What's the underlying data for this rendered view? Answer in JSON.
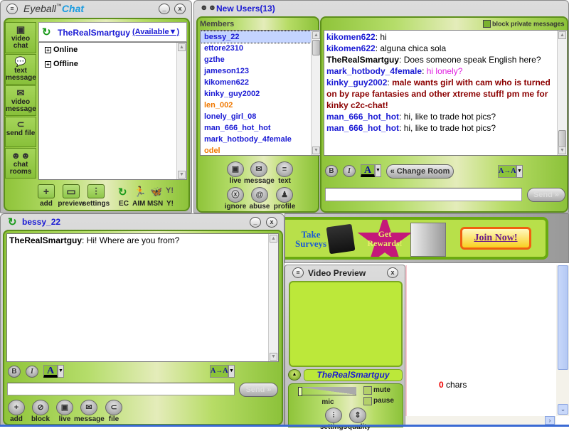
{
  "main_window": {
    "title_brand": "Eyeball",
    "title_tm": "™",
    "title_suffix": "Chat",
    "user": "TheRealSmartguy",
    "status": "(Available▼)",
    "groups": [
      "Online",
      "Offline"
    ],
    "sidebar": [
      {
        "icon": "video-chat",
        "label": "video chat"
      },
      {
        "icon": "text-message",
        "label": "text message"
      },
      {
        "icon": "video-message",
        "label": "video message"
      },
      {
        "icon": "send-file",
        "label": "send file"
      },
      {
        "icon": "chat-rooms",
        "label": "chat rooms"
      }
    ],
    "toolbar": [
      {
        "icon": "plus",
        "label": "add"
      },
      {
        "icon": "monitor",
        "label": "preview"
      },
      {
        "icon": "sliders",
        "label": "settings"
      }
    ],
    "networks": [
      "EC",
      "AIM",
      "MSN",
      "Y!"
    ]
  },
  "room_window": {
    "title": "New Users(13)",
    "members_label": "Members",
    "members": [
      {
        "name": "bessy_22",
        "color": "#1a1ad4",
        "selected": true
      },
      {
        "name": "ettore2310",
        "color": "#1a1ad4"
      },
      {
        "name": "gzthe",
        "color": "#1a1ad4"
      },
      {
        "name": "jameson123",
        "color": "#1a1ad4"
      },
      {
        "name": "kikomen622",
        "color": "#1a1ad4"
      },
      {
        "name": "kinky_guy2002",
        "color": "#1a1ad4"
      },
      {
        "name": "len_002",
        "color": "#f07800"
      },
      {
        "name": "lonely_girl_08",
        "color": "#1a1ad4"
      },
      {
        "name": "man_666_hot_hot",
        "color": "#1a1ad4"
      },
      {
        "name": "mark_hotbody_4female",
        "color": "#1a1ad4"
      },
      {
        "name": "odel",
        "color": "#f07800"
      }
    ],
    "actions_row1": [
      {
        "icon": "camera",
        "label": "live"
      },
      {
        "icon": "video-mail",
        "label": "message"
      },
      {
        "icon": "speech-bubble",
        "label": "text"
      }
    ],
    "actions_row2": [
      {
        "icon": "ignore",
        "label": "ignore"
      },
      {
        "icon": "abuse",
        "label": "abuse"
      },
      {
        "icon": "person",
        "label": "profile"
      }
    ],
    "block_private_label": "block private messages",
    "messages": [
      {
        "user": "kikomen622",
        "user_color": "#1a1ad4",
        "text": "hi",
        "text_color": "#000",
        "bold": false
      },
      {
        "user": "kikomen622",
        "user_color": "#1a1ad4",
        "text": "alguna chica sola",
        "text_color": "#000",
        "bold": false
      },
      {
        "user": "TheRealSmartguy",
        "user_color": "#000",
        "text": "Does someone speak English here?",
        "text_color": "#000",
        "bold": false
      },
      {
        "user": "mark_hotbody_4female",
        "user_color": "#1a1ad4",
        "text": "hi lonely?",
        "text_color": "#e020e0",
        "bold": false
      },
      {
        "user": "kinky_guy2002",
        "user_color": "#1a1ad4",
        "text": "male wants girl with cam who is turned on by rape fantasies and other xtreme stuff! pm me for kinky c2c-chat!",
        "text_color": "#8b0000",
        "bold": true
      },
      {
        "user": "man_666_hot_hot",
        "user_color": "#1a1ad4",
        "text": "hi, like to trade hot pics?",
        "text_color": "#000",
        "bold": false
      },
      {
        "user": "man_666_hot_hot",
        "user_color": "#1a1ad4",
        "text": "hi, like to trade hot pics?",
        "text_color": "#000",
        "bold": false
      }
    ],
    "bold_label": "B",
    "italic_label": "I",
    "color_label": "A",
    "change_room_label": "« Change Room",
    "font_size_label": "A→A",
    "input_value": "",
    "send_label": "Send »"
  },
  "private_window": {
    "title": "bessy_22",
    "messages": [
      {
        "user": "TheRealSmartguy",
        "text": "Hi! Where are you from?"
      }
    ],
    "bold_label": "B",
    "italic_label": "I",
    "color_label": "A",
    "font_size_label": "A→A",
    "input_value": "",
    "send_label": "Send »",
    "actions": [
      {
        "icon": "plus",
        "label": "add"
      },
      {
        "icon": "block",
        "label": "block"
      },
      {
        "icon": "camera",
        "label": "live"
      },
      {
        "icon": "video-mail",
        "label": "message"
      },
      {
        "icon": "paperclip",
        "label": "file"
      }
    ]
  },
  "ad_banner": {
    "left_text": "Take Surveys",
    "star_text": "Get Rewards!",
    "button_label": "Join Now!"
  },
  "video_preview": {
    "title": "Video Preview",
    "user": "TheRealSmartguy",
    "mic_label": "mic",
    "mic_level": 0.0,
    "mute_label": "mute",
    "pause_label": "pause",
    "settings_label": "settings",
    "quality_label": "quality"
  },
  "char_counter": {
    "count": "0",
    "suffix": " chars"
  }
}
